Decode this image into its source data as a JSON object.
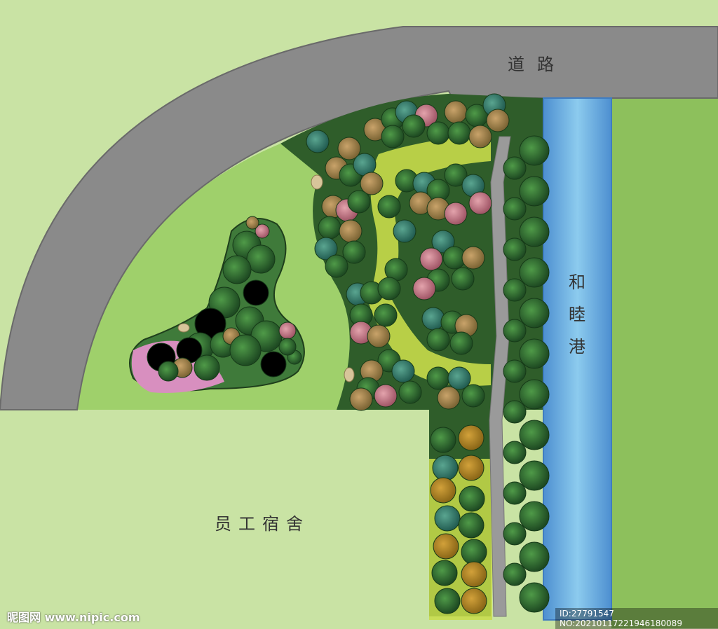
{
  "labels": {
    "road": "道路",
    "dormitory": "员工宿舍",
    "river": [
      "和",
      "睦",
      "港"
    ]
  },
  "watermarks": {
    "site": "昵图网 www.nipic.com",
    "image_id": "ID:27791547 NO:20210117221946180089"
  },
  "colors": {
    "lawn_light": "#c9e3a4",
    "lawn_mid": "#9fd06b",
    "lawn_right": "#8dc05c",
    "road": "#8a8a8a",
    "woodland": "#2f5d2a",
    "path_yellow": "#c8dc4a",
    "river": "#6eaee0",
    "flower_pink": "#d88fbf",
    "stone_path": "#9a9a9a"
  }
}
